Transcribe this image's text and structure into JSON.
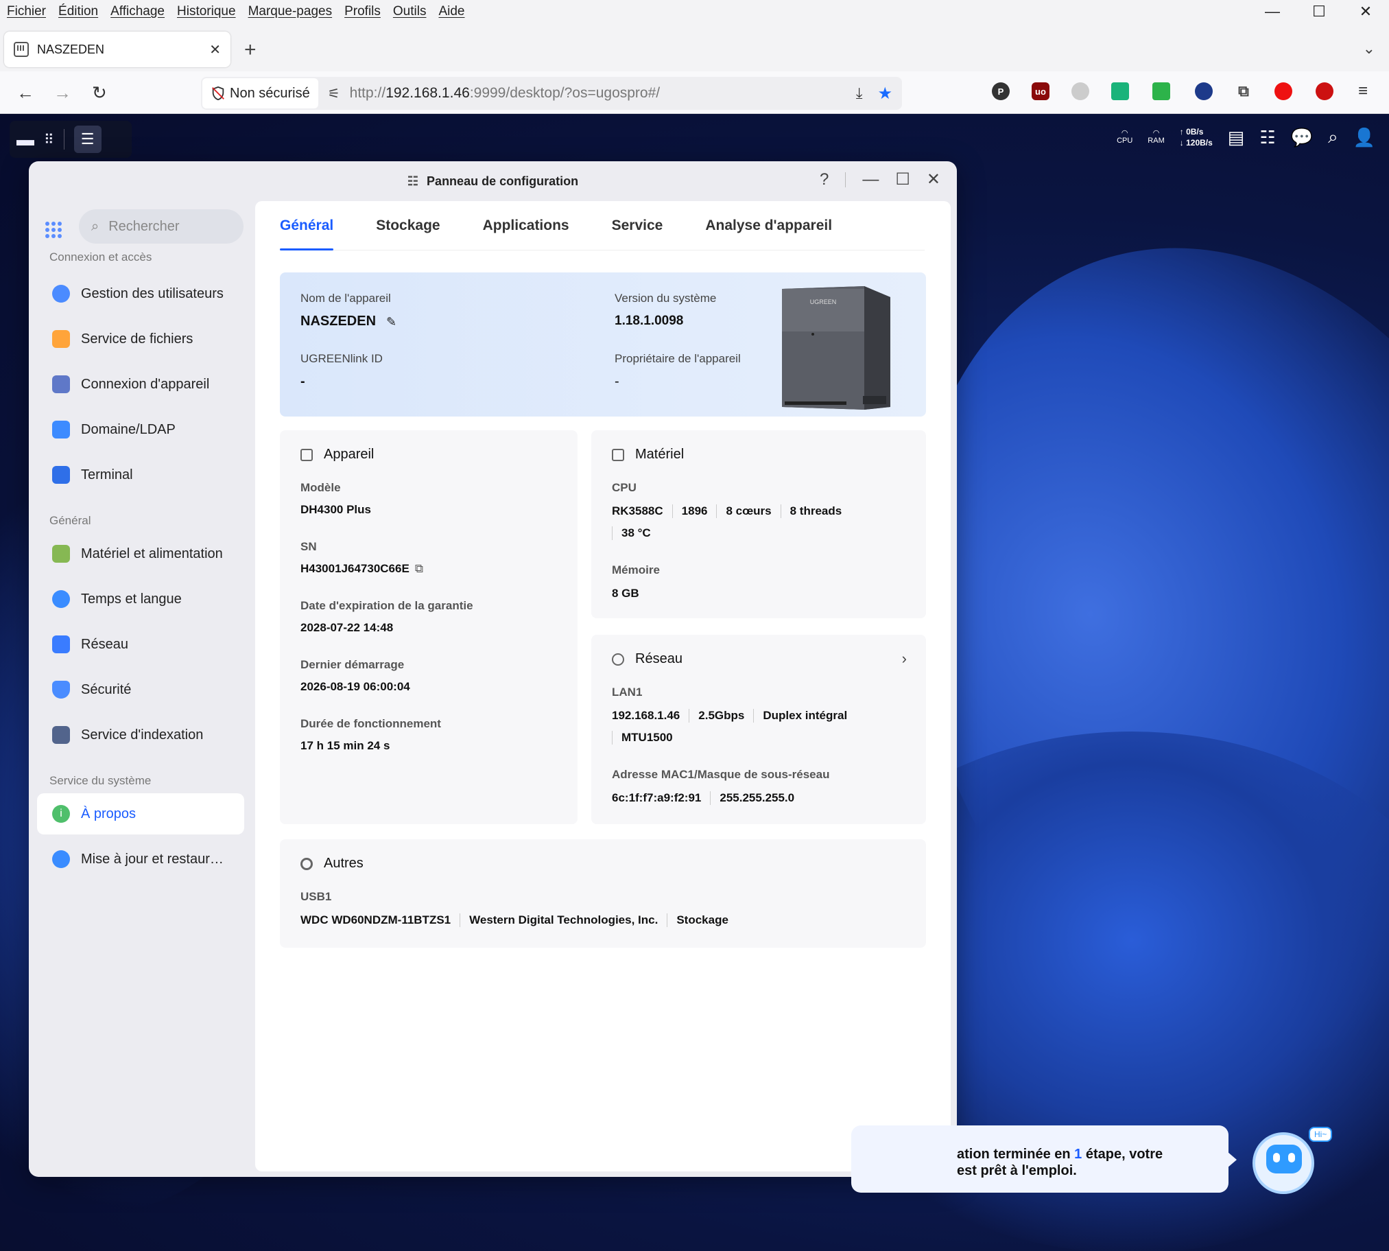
{
  "browser": {
    "menu": [
      "Fichier",
      "Édition",
      "Affichage",
      "Historique",
      "Marque-pages",
      "Profils",
      "Outils",
      "Aide"
    ],
    "tab_title": "NASZEDEN",
    "security_label": "Non sécurisé",
    "url_prefix": "http://",
    "url_host": "192.168.1.46",
    "url_rest": ":9999/desktop/?os=ugospro#/"
  },
  "topbar": {
    "cpu_label": "CPU",
    "ram_label": "RAM",
    "upload": "0B/s",
    "download": "120B/s"
  },
  "window": {
    "title": "Panneau de configuration",
    "help": "?",
    "search_placeholder": "Rechercher",
    "sections": {
      "access": "Connexion et accès",
      "general": "Général",
      "system": "Service du système"
    },
    "sidebar": [
      {
        "label": "Gestion des utilisateurs",
        "color": "#4b8bff"
      },
      {
        "label": "Service de fichiers",
        "color": "#ffa43a"
      },
      {
        "label": "Connexion d'appareil",
        "color": "#5f78c8"
      },
      {
        "label": "Domaine/LDAP",
        "color": "#3d8bff"
      },
      {
        "label": "Terminal",
        "color": "#2f6fe8"
      },
      {
        "label": "Matériel et alimentation",
        "color": "#86b853"
      },
      {
        "label": "Temps et langue",
        "color": "#3a8cff"
      },
      {
        "label": "Réseau",
        "color": "#3a7cff"
      },
      {
        "label": "Sécurité",
        "color": "#4a8cff"
      },
      {
        "label": "Service d'indexation",
        "color": "#52648c"
      },
      {
        "label": "À propos",
        "color": "#4fbf6b"
      },
      {
        "label": "Mise à jour et restaur…",
        "color": "#3a8cff"
      }
    ],
    "tabs": [
      "Général",
      "Stockage",
      "Applications",
      "Service",
      "Analyse d'appareil"
    ],
    "hero": {
      "device_name_label": "Nom de l'appareil",
      "device_name": "NASZEDEN",
      "version_label": "Version du système",
      "version": "1.18.1.0098",
      "link_label": "UGREENlink ID",
      "link_value": "-",
      "owner_label": "Propriétaire de l'appareil",
      "owner_value": "-",
      "nas_brand": "UGREEN"
    },
    "device": {
      "title": "Appareil",
      "model_label": "Modèle",
      "model": "DH4300 Plus",
      "sn_label": "SN",
      "sn": "H43001J64730C66E",
      "warranty_label": "Date d'expiration de la garantie",
      "warranty": "2028-07-22 14:48",
      "boot_label": "Dernier démarrage",
      "boot": "2026-08-19 06:00:04",
      "uptime_label": "Durée de fonctionnement",
      "uptime": "17 h 15 min 24 s"
    },
    "hardware": {
      "title": "Matériel",
      "cpu_label": "CPU",
      "cpu": [
        "RK3588C",
        "1896",
        "8 cœurs",
        "8 threads"
      ],
      "temp": "38 °C",
      "mem_label": "Mémoire",
      "mem": "8 GB"
    },
    "network": {
      "title": "Réseau",
      "lan_label": "LAN1",
      "lan": [
        "192.168.1.46",
        "2.5Gbps",
        "Duplex intégral"
      ],
      "mtu": "MTU1500",
      "mac_label": "Adresse MAC1/Masque de sous-réseau",
      "mac": [
        "6c:1f:f7:a9:f2:91",
        "255.255.255.0"
      ]
    },
    "others": {
      "title": "Autres",
      "usb_label": "USB1",
      "usb": [
        "WDC WD60NDZM-11BTZS1",
        "Western Digital Technologies, Inc.",
        "Stockage"
      ]
    }
  },
  "toast": {
    "line1_a": "ation terminée en ",
    "line1_num": "1",
    "line1_b": " étape, votre",
    "line2": "est prêt à l'emploi.",
    "badge": "Hi~"
  }
}
